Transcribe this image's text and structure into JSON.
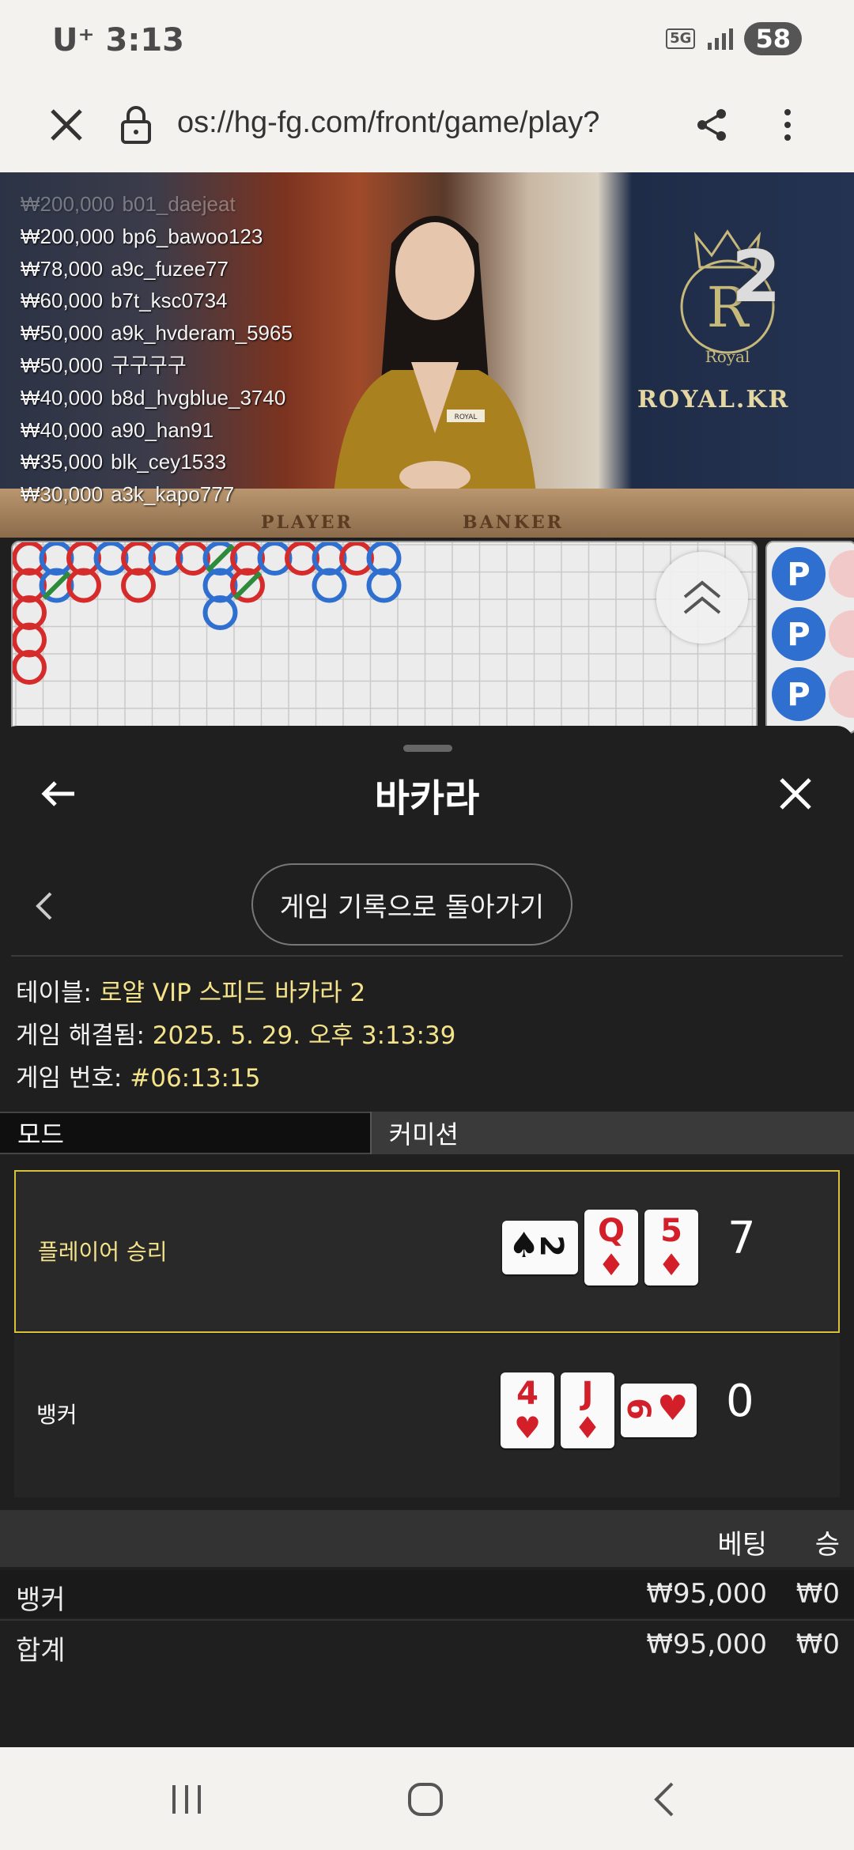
{
  "status_bar": {
    "carrier": "U⁺ 3:13",
    "network": "5G",
    "battery": "58"
  },
  "browser": {
    "url": "os://hg-fg.com/front/game/play?"
  },
  "video": {
    "bets": [
      {
        "amount": "₩200,000",
        "user": "b01_daejeat"
      },
      {
        "amount": "₩200,000",
        "user": "bp6_bawoo123"
      },
      {
        "amount": "₩78,000",
        "user": "a9c_fuzee77"
      },
      {
        "amount": "₩60,000",
        "user": "b7t_ksc0734"
      },
      {
        "amount": "₩50,000",
        "user": "a9k_hvderam_5965"
      },
      {
        "amount": "₩50,000",
        "user": "구구구구"
      },
      {
        "amount": "₩40,000",
        "user": "b8d_hvgblue_3740"
      },
      {
        "amount": "₩40,000",
        "user": "a90_han91"
      },
      {
        "amount": "₩35,000",
        "user": "blk_cey1533"
      },
      {
        "amount": "₩30,000",
        "user": "a3k_kapo777"
      }
    ],
    "round_number": "2",
    "brand": "ROYAL.KR",
    "crest_letter": "R",
    "crest_word": "Royal",
    "table_label_player": "PLAYER",
    "table_label_banker": "BANKER",
    "name_tag": "ROYAL"
  },
  "road_side": {
    "marker": "P"
  },
  "sheet": {
    "title": "바카라",
    "history_button": "게임 기록으로 돌아가기",
    "info": [
      {
        "key": "테이블:",
        "value": "로얄 VIP 스피드 바카라 2"
      },
      {
        "key": "게임 해결됨:",
        "value": "2025. 5. 29. 오후 3:13:39"
      },
      {
        "key": "게임 번호:",
        "value": "#06:13:15"
      }
    ],
    "tabs": {
      "mode": "모드",
      "commission": "커미션"
    },
    "player": {
      "label": "플레이어 승리",
      "score": "7",
      "cards": [
        {
          "rank": "2",
          "suit": "♠"
        },
        {
          "rank": "Q",
          "suit": "♦"
        },
        {
          "rank": "5",
          "suit": "♦"
        }
      ]
    },
    "banker": {
      "label": "뱅커",
      "score": "0",
      "cards": [
        {
          "rank": "4",
          "suit": "♥"
        },
        {
          "rank": "J",
          "suit": "♦"
        },
        {
          "rank": "6",
          "suit": "♥"
        }
      ]
    },
    "summary": {
      "headers": {
        "bet": "베팅",
        "win": "승"
      },
      "rows": [
        {
          "label": "뱅커",
          "bet": "₩95,000",
          "win": "₩0"
        },
        {
          "label": "합계",
          "bet": "₩95,000",
          "win": "₩0"
        }
      ]
    }
  },
  "colors": {
    "accent": "#f4e38a",
    "highlight_border": "#d6c03c",
    "player_blue": "#2e6fd0",
    "banker_red": "#d52b2b"
  }
}
